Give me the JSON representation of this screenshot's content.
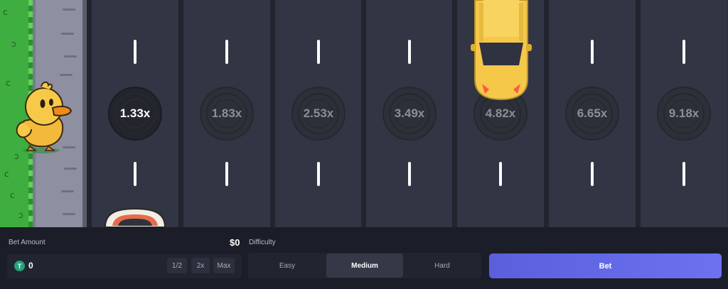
{
  "game": {
    "multipliers": [
      "1.33x",
      "1.83x",
      "2.53x",
      "3.49x",
      "4.82x",
      "6.65x",
      "9.18x"
    ],
    "active_multiplier_index": 0
  },
  "controls": {
    "bet_amount_label": "Bet Amount",
    "usd_value": "$0",
    "token_symbol": "T",
    "bet_value": "0",
    "half_label": "1/2",
    "double_label": "2x",
    "max_label": "Max",
    "difficulty_label": "Difficulty",
    "difficulty_options": [
      "Easy",
      "Medium",
      "Hard"
    ],
    "selected_difficulty": "Medium",
    "bet_button_label": "Bet"
  },
  "colors": {
    "bet_button": "#5a60dc",
    "road": "#323543",
    "car": "#f5c84a",
    "duck": "#f7c948"
  }
}
